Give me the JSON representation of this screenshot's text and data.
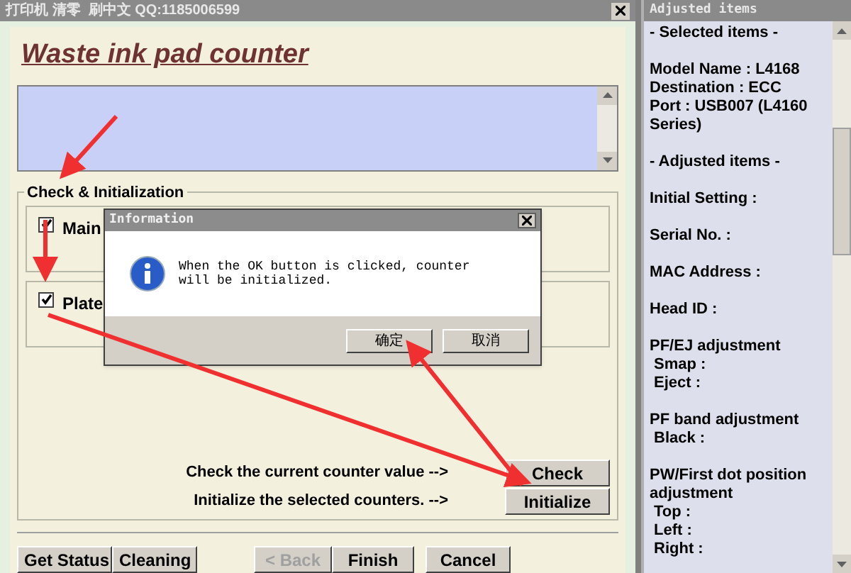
{
  "window": {
    "title": "打印机 清零  刷中文 QQ:1185006599"
  },
  "heading": "Waste ink pad counter",
  "group": {
    "title": "Check & Initialization",
    "counters": [
      {
        "label": "Main",
        "checked": true
      },
      {
        "label": "Plate",
        "checked": true
      }
    ],
    "actions": [
      {
        "text": "Check the current counter value -->",
        "button": "Check"
      },
      {
        "text": "Initialize the selected counters. -->",
        "button": "Initialize"
      }
    ]
  },
  "footer_buttons": [
    {
      "label": "Get Status",
      "disabled": false
    },
    {
      "label": "Cleaning",
      "disabled": false
    },
    {
      "label": "< Back",
      "disabled": true
    },
    {
      "label": "Finish",
      "disabled": false
    },
    {
      "label": "Cancel",
      "disabled": false
    }
  ],
  "dialog": {
    "title": "Information",
    "message": "When the OK button is clicked, counter will be initialized.",
    "buttons": [
      "确定",
      "取消"
    ]
  },
  "side_panel": {
    "title": "Adjusted items",
    "blocks": [
      {
        "title": "- Selected items -"
      },
      {
        "children": [
          "Model Name : L4168",
          "Destination : ECC",
          "Port : USB007 (L4160 Series)"
        ]
      },
      {
        "title": "- Adjusted items -"
      },
      {
        "title": "Initial Setting :"
      },
      {
        "title": "Serial No. :"
      },
      {
        "title": "MAC Address :"
      },
      {
        "title": "Head ID :"
      },
      {
        "title": "PF/EJ adjustment",
        "children": [
          "Smap :",
          "Eject :"
        ]
      },
      {
        "title": "PF band adjustment",
        "children": [
          "Black :"
        ]
      },
      {
        "title": "PW/First dot position adjustment",
        "children": [
          "Top :",
          "Left :",
          "Right :"
        ]
      }
    ]
  }
}
